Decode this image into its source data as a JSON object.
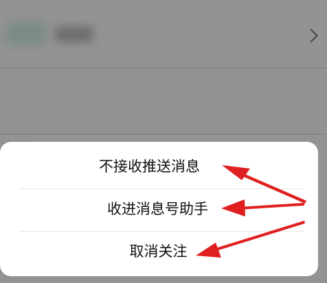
{
  "action_sheet": {
    "items": [
      {
        "label": "不接收推送消息"
      },
      {
        "label": "收进消息号助手"
      },
      {
        "label": "取消关注"
      }
    ]
  },
  "colors": {
    "overlay": "#000000",
    "sheet_background": "#ffffff",
    "annotation_arrow": "#e02020"
  },
  "icons": {
    "list_row_chevron": "chevron-right-icon"
  }
}
